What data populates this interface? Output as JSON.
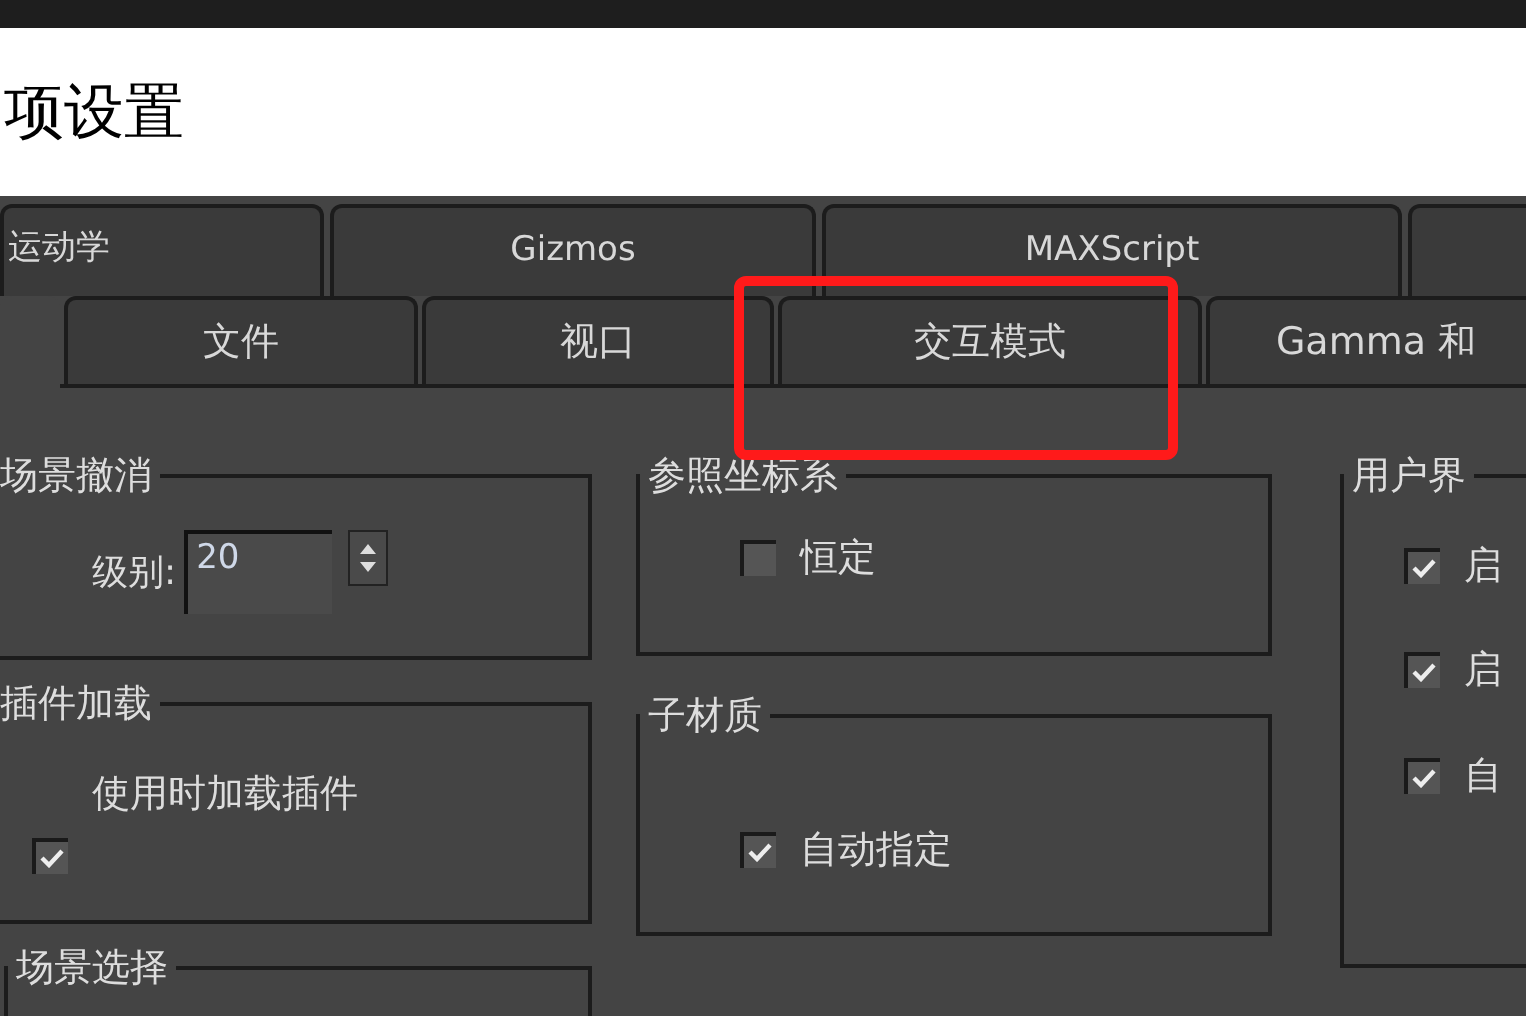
{
  "window": {
    "title": "项设置"
  },
  "tab_rows": [
    [
      {
        "label": "运动学",
        "selected": false
      },
      {
        "label": "Gizmos",
        "selected": false
      },
      {
        "label": "MAXScript",
        "selected": false
      },
      {
        "selected": false
      }
    ],
    [
      {
        "selected": true
      },
      {
        "label": "文件",
        "selected": false
      },
      {
        "label": "视口",
        "selected": false
      },
      {
        "label": "交互模式",
        "selected": false
      },
      {
        "label": "Gamma 和",
        "selected": false
      }
    ]
  ],
  "groups": [
    {
      "title": "场景撤消",
      "items": [
        {
          "kind": "spinner",
          "label": "级别:",
          "value": "20"
        }
      ]
    },
    {
      "title": "参照坐标系",
      "items": [
        {
          "kind": "checkbox",
          "label": "恒定",
          "checked": false
        }
      ]
    },
    {
      "title": "用户界",
      "items": [
        {
          "kind": "checkbox",
          "label": "启",
          "checked": true
        },
        {
          "kind": "checkbox",
          "label": "启",
          "checked": true
        },
        {
          "kind": "checkbox",
          "label": "自",
          "checked": true
        }
      ]
    },
    {
      "title": "插件加载",
      "items": [
        {
          "kind": "checkbox_above",
          "label": "使用时加载插件",
          "checked": true
        }
      ]
    },
    {
      "title": "子材质",
      "items": [
        {
          "kind": "checkbox",
          "label": "自动指定",
          "checked": true
        }
      ]
    },
    {
      "title": "场景选择"
    }
  ]
}
